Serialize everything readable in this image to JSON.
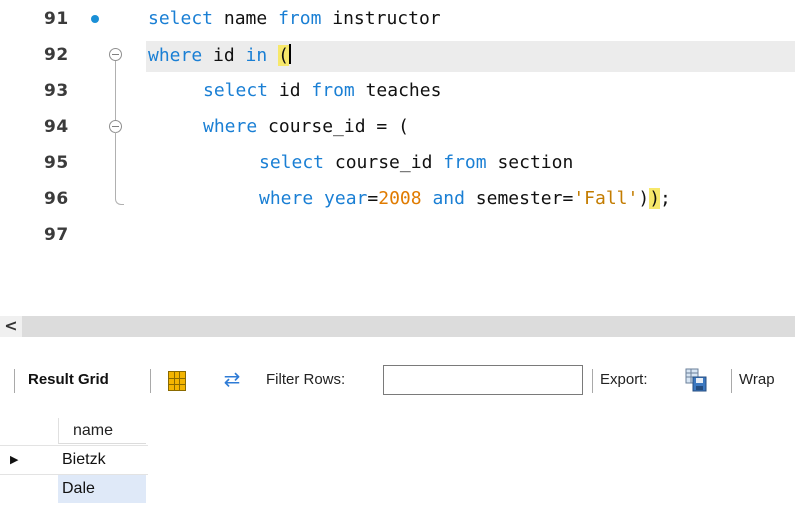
{
  "editor": {
    "lines": [
      {
        "num": "91",
        "segments": [
          [
            "kw",
            "select"
          ],
          [
            "t",
            " name "
          ],
          [
            "kw",
            "from"
          ],
          [
            "t",
            " instructor"
          ]
        ]
      },
      {
        "num": "92",
        "segments": [
          [
            "kw",
            "where"
          ],
          [
            "t",
            " id "
          ],
          [
            "kw",
            "in"
          ],
          [
            "t",
            " "
          ],
          [
            "hl",
            "("
          ]
        ]
      },
      {
        "num": "93",
        "segments": [
          [
            "kw",
            "select"
          ],
          [
            "t",
            " id "
          ],
          [
            "kw",
            "from"
          ],
          [
            "t",
            " teaches"
          ]
        ]
      },
      {
        "num": "94",
        "segments": [
          [
            "kw",
            "where"
          ],
          [
            "t",
            " course_id = ("
          ]
        ]
      },
      {
        "num": "95",
        "segments": [
          [
            "kw",
            "select"
          ],
          [
            "t",
            " course_id "
          ],
          [
            "kw",
            "from"
          ],
          [
            "t",
            " section"
          ]
        ]
      },
      {
        "num": "96",
        "segments": [
          [
            "kw",
            "where"
          ],
          [
            "t",
            " "
          ],
          [
            "kw",
            "year"
          ],
          [
            "t",
            "="
          ],
          [
            "num",
            "2008"
          ],
          [
            "t",
            " "
          ],
          [
            "kw",
            "and"
          ],
          [
            "t",
            " semester="
          ],
          [
            "str",
            "'Fall'"
          ],
          [
            "t",
            ")"
          ],
          [
            "hl",
            ")"
          ],
          [
            "t",
            ";"
          ]
        ]
      },
      {
        "num": "97",
        "segments": []
      }
    ]
  },
  "colors": {
    "keyword": "#1a7fd4",
    "number": "#e07b00",
    "string": "#c37c00",
    "bracket_highlight": "#f7e86a",
    "breakpoint": "#1a8fd6"
  },
  "scrollbar": {
    "left_arrow": "<"
  },
  "toolbar": {
    "result_grid_label": "Result Grid",
    "filter_label": "Filter Rows:",
    "filter_value": "",
    "export_label": "Export:",
    "wrap_label": "Wrap"
  },
  "grid": {
    "column_header": "name",
    "rows": [
      "Bietzk",
      "Dale"
    ],
    "selected_row_marker": "▶"
  }
}
